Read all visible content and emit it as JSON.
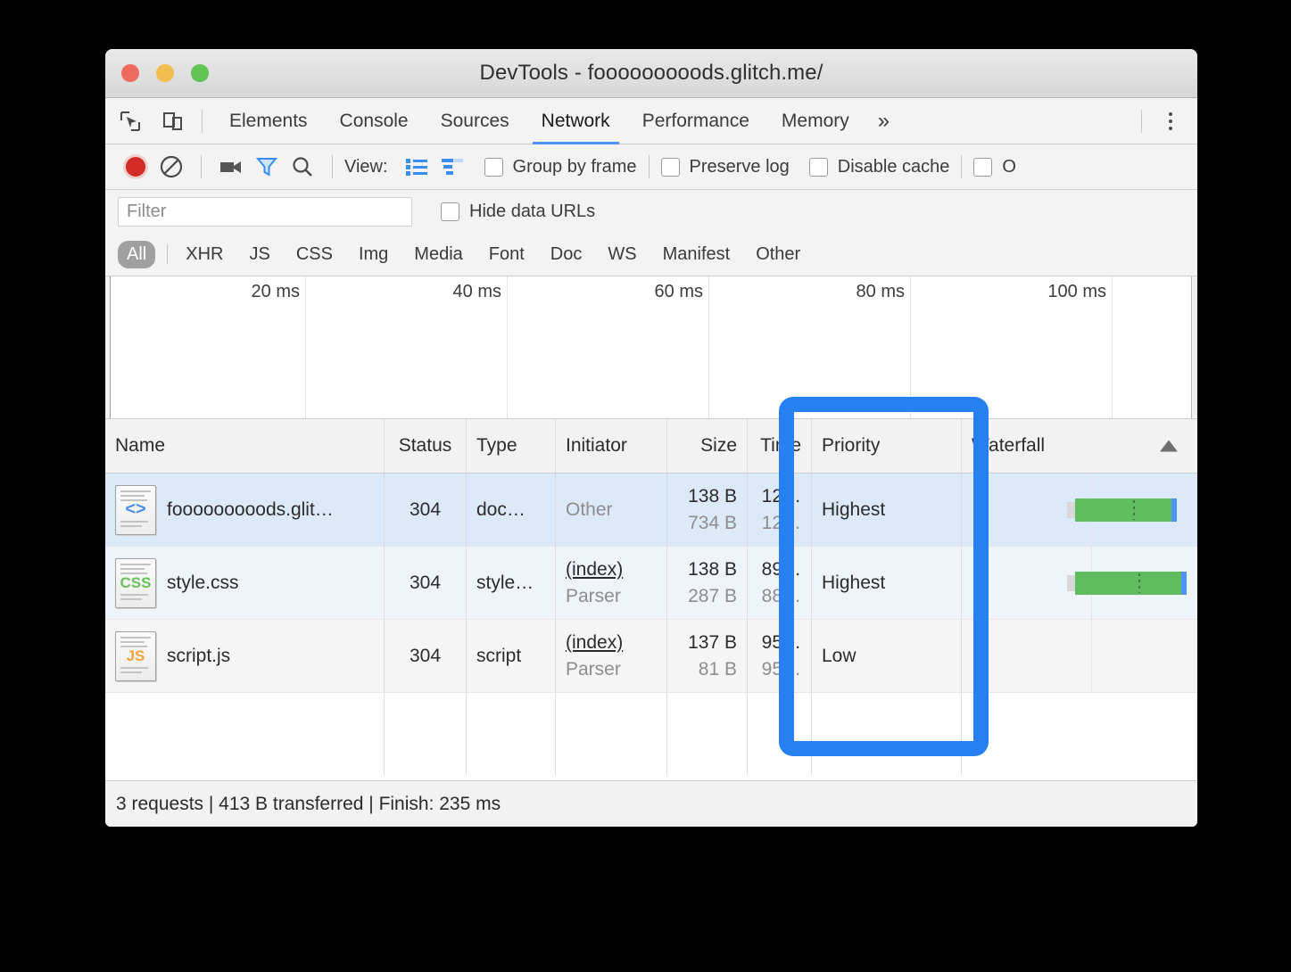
{
  "window": {
    "title": "DevTools - fooooooooods.glitch.me/",
    "traffic_lights": [
      "close-red",
      "minimize-yellow",
      "zoom-green"
    ]
  },
  "tabs": {
    "items": [
      {
        "label": "Elements",
        "active": false
      },
      {
        "label": "Console",
        "active": false
      },
      {
        "label": "Sources",
        "active": false
      },
      {
        "label": "Network",
        "active": true
      },
      {
        "label": "Performance",
        "active": false
      },
      {
        "label": "Memory",
        "active": false
      }
    ],
    "more_label": "»",
    "inspect_icon": "inspect-element-icon",
    "device_icon": "device-toolbar-icon",
    "menu_icon": "kebab-menu-icon"
  },
  "network_toolbar": {
    "record_icon": "record-button-icon",
    "clear_icon": "clear-icon",
    "capture_screenshots_icon": "camera-icon",
    "filter_icon": "filter-funnel-icon",
    "search_icon": "search-icon",
    "view_label": "View:",
    "view_list_icon": "list-view-icon",
    "view_waterfall_icon": "waterfall-view-icon",
    "checkboxes": [
      {
        "label": "Group by frame",
        "checked": false
      },
      {
        "label": "Preserve log",
        "checked": false
      },
      {
        "label": "Disable cache",
        "checked": false
      },
      {
        "label": "O",
        "checked": false
      }
    ]
  },
  "filter_bar": {
    "placeholder": "Filter",
    "value": "",
    "hide_data_urls": {
      "label": "Hide data URLs",
      "checked": false
    }
  },
  "type_filters": {
    "items": [
      "All",
      "XHR",
      "JS",
      "CSS",
      "Img",
      "Media",
      "Font",
      "Doc",
      "WS",
      "Manifest",
      "Other"
    ],
    "active": "All"
  },
  "overview": {
    "ticks": [
      "20 ms",
      "40 ms",
      "60 ms",
      "80 ms",
      "100 ms"
    ]
  },
  "table": {
    "headers": [
      "Name",
      "Status",
      "Type",
      "Initiator",
      "Size",
      "Time",
      "Priority",
      "Waterfall"
    ],
    "sort_indicator": "sort-ascending-arrow",
    "rows": [
      {
        "icon": "document-icon",
        "icon_glyph": "<>",
        "name": "fooooooooods.glit…",
        "status": "304",
        "type": "doc…",
        "initiator_main": "Other",
        "initiator_sub": "",
        "initiator_link": false,
        "size_main": "138 B",
        "size_sub": "734 B",
        "time_main": "12…",
        "time_sub": "12…",
        "priority": "Highest",
        "waterfall_start_pct": 48,
        "waterfall_width_pct": 41,
        "selected": true
      },
      {
        "icon": "stylesheet-icon",
        "icon_glyph": "CSS",
        "name": "style.css",
        "status": "304",
        "type": "style…",
        "initiator_main": "(index)",
        "initiator_sub": "Parser",
        "initiator_link": true,
        "size_main": "138 B",
        "size_sub": "287 B",
        "time_main": "89…",
        "time_sub": "88…",
        "priority": "Highest",
        "waterfall_start_pct": 48,
        "waterfall_width_pct": 45,
        "selected": false
      },
      {
        "icon": "script-icon",
        "icon_glyph": "JS",
        "name": "script.js",
        "status": "304",
        "type": "script",
        "initiator_main": "(index)",
        "initiator_sub": "Parser",
        "initiator_link": true,
        "size_main": "137 B",
        "size_sub": "81 B",
        "time_main": "95…",
        "time_sub": "95…",
        "priority": "Low",
        "waterfall_start_pct": 0,
        "waterfall_width_pct": 0,
        "selected": false
      }
    ]
  },
  "status_bar": {
    "text": "3 requests | 413 B transferred | Finish: 235 ms"
  },
  "annotation": {
    "target": "priority-column",
    "color": "#2680f2"
  }
}
